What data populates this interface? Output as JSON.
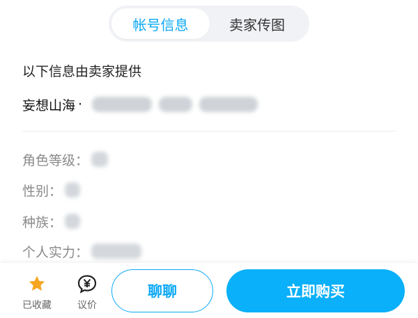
{
  "tabs": [
    {
      "label": "帐号信息",
      "active": true
    },
    {
      "label": "卖家传图",
      "active": false
    }
  ],
  "intro_text": "以下信息由卖家提供",
  "seller": {
    "name": "妄想山海",
    "separator": "·"
  },
  "attributes": [
    {
      "label": "角色等级："
    },
    {
      "label": "性别："
    },
    {
      "label": "种族："
    },
    {
      "label": "个人实力："
    }
  ],
  "footer": {
    "favorite_label": "已收藏",
    "bargain_label": "议价",
    "chat_label": "聊聊",
    "buy_label": "立即购买"
  },
  "colors": {
    "accent": "#0aa8f5",
    "star": "#f6a623",
    "buy_button": "#0ab0f9"
  },
  "icons": {
    "favorite": "star-icon",
    "bargain": "yen-bubble-icon"
  }
}
